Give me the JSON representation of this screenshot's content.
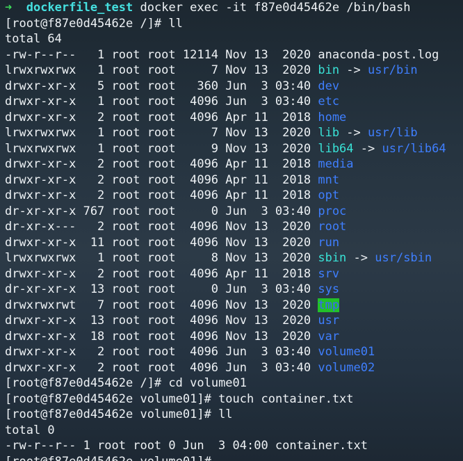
{
  "header": {
    "arrow": "➜",
    "cwd": "dockerfile_test",
    "command": "docker exec -it f87e0d45462e /bin/bash"
  },
  "session": [
    {
      "prompt": "[root@f87e0d45462e /]#",
      "command": "ll"
    },
    {
      "text": "total 64"
    }
  ],
  "listing": [
    {
      "perm": "-rw-r--r--",
      "links": "1",
      "owner": "root",
      "group": "root",
      "size": "12114",
      "month": "Nov",
      "day": "13",
      "time": "2020",
      "name": "anaconda-post.log",
      "type": "file"
    },
    {
      "perm": "lrwxrwxrwx",
      "links": "1",
      "owner": "root",
      "group": "root",
      "size": "7",
      "month": "Nov",
      "day": "13",
      "time": "2020",
      "name": "bin",
      "type": "link",
      "target": "usr/bin"
    },
    {
      "perm": "drwxr-xr-x",
      "links": "5",
      "owner": "root",
      "group": "root",
      "size": "360",
      "month": "Jun",
      "day": "3",
      "time": "03:40",
      "name": "dev",
      "type": "dir"
    },
    {
      "perm": "drwxr-xr-x",
      "links": "1",
      "owner": "root",
      "group": "root",
      "size": "4096",
      "month": "Jun",
      "day": "3",
      "time": "03:40",
      "name": "etc",
      "type": "dir"
    },
    {
      "perm": "drwxr-xr-x",
      "links": "2",
      "owner": "root",
      "group": "root",
      "size": "4096",
      "month": "Apr",
      "day": "11",
      "time": "2018",
      "name": "home",
      "type": "dir"
    },
    {
      "perm": "lrwxrwxrwx",
      "links": "1",
      "owner": "root",
      "group": "root",
      "size": "7",
      "month": "Nov",
      "day": "13",
      "time": "2020",
      "name": "lib",
      "type": "link",
      "target": "usr/lib"
    },
    {
      "perm": "lrwxrwxrwx",
      "links": "1",
      "owner": "root",
      "group": "root",
      "size": "9",
      "month": "Nov",
      "day": "13",
      "time": "2020",
      "name": "lib64",
      "type": "link",
      "target": "usr/lib64"
    },
    {
      "perm": "drwxr-xr-x",
      "links": "2",
      "owner": "root",
      "group": "root",
      "size": "4096",
      "month": "Apr",
      "day": "11",
      "time": "2018",
      "name": "media",
      "type": "dir"
    },
    {
      "perm": "drwxr-xr-x",
      "links": "2",
      "owner": "root",
      "group": "root",
      "size": "4096",
      "month": "Apr",
      "day": "11",
      "time": "2018",
      "name": "mnt",
      "type": "dir"
    },
    {
      "perm": "drwxr-xr-x",
      "links": "2",
      "owner": "root",
      "group": "root",
      "size": "4096",
      "month": "Apr",
      "day": "11",
      "time": "2018",
      "name": "opt",
      "type": "dir"
    },
    {
      "perm": "dr-xr-xr-x",
      "links": "767",
      "owner": "root",
      "group": "root",
      "size": "0",
      "month": "Jun",
      "day": "3",
      "time": "03:40",
      "name": "proc",
      "type": "dir"
    },
    {
      "perm": "dr-xr-x---",
      "links": "2",
      "owner": "root",
      "group": "root",
      "size": "4096",
      "month": "Nov",
      "day": "13",
      "time": "2020",
      "name": "root",
      "type": "dir"
    },
    {
      "perm": "drwxr-xr-x",
      "links": "11",
      "owner": "root",
      "group": "root",
      "size": "4096",
      "month": "Nov",
      "day": "13",
      "time": "2020",
      "name": "run",
      "type": "dir"
    },
    {
      "perm": "lrwxrwxrwx",
      "links": "1",
      "owner": "root",
      "group": "root",
      "size": "8",
      "month": "Nov",
      "day": "13",
      "time": "2020",
      "name": "sbin",
      "type": "link",
      "target": "usr/sbin"
    },
    {
      "perm": "drwxr-xr-x",
      "links": "2",
      "owner": "root",
      "group": "root",
      "size": "4096",
      "month": "Apr",
      "day": "11",
      "time": "2018",
      "name": "srv",
      "type": "dir"
    },
    {
      "perm": "dr-xr-xr-x",
      "links": "13",
      "owner": "root",
      "group": "root",
      "size": "0",
      "month": "Jun",
      "day": "3",
      "time": "03:40",
      "name": "sys",
      "type": "dir"
    },
    {
      "perm": "drwxrwxrwt",
      "links": "7",
      "owner": "root",
      "group": "root",
      "size": "4096",
      "month": "Nov",
      "day": "13",
      "time": "2020",
      "name": "tmp",
      "type": "sticky"
    },
    {
      "perm": "drwxr-xr-x",
      "links": "13",
      "owner": "root",
      "group": "root",
      "size": "4096",
      "month": "Nov",
      "day": "13",
      "time": "2020",
      "name": "usr",
      "type": "dir"
    },
    {
      "perm": "drwxr-xr-x",
      "links": "18",
      "owner": "root",
      "group": "root",
      "size": "4096",
      "month": "Nov",
      "day": "13",
      "time": "2020",
      "name": "var",
      "type": "dir"
    },
    {
      "perm": "drwxr-xr-x",
      "links": "2",
      "owner": "root",
      "group": "root",
      "size": "4096",
      "month": "Jun",
      "day": "3",
      "time": "03:40",
      "name": "volume01",
      "type": "dir"
    },
    {
      "perm": "drwxr-xr-x",
      "links": "2",
      "owner": "root",
      "group": "root",
      "size": "4096",
      "month": "Jun",
      "day": "3",
      "time": "03:40",
      "name": "volume02",
      "type": "dir"
    }
  ],
  "after": [
    {
      "prompt": "[root@f87e0d45462e /]#",
      "command": "cd volume01"
    },
    {
      "prompt": "[root@f87e0d45462e volume01]#",
      "command": "touch container.txt"
    },
    {
      "prompt": "[root@f87e0d45462e volume01]#",
      "command": "ll"
    },
    {
      "text": "total 0"
    },
    {
      "text": "-rw-r--r-- 1 root root 0 Jun  3 04:00 container.txt"
    },
    {
      "prompt": "[root@f87e0d45462e volume01]#",
      "command": ""
    }
  ],
  "colors": {
    "arrow": "#3ddc5a",
    "cwd": "#45e0e0",
    "dir": "#3f7fff",
    "link": "#39e3d7",
    "sticky_bg": "#22c02a"
  }
}
